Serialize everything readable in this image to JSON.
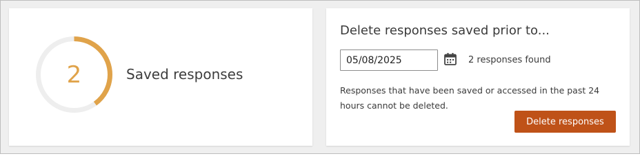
{
  "saved_summary": {
    "count": "2",
    "label": "Saved responses",
    "ring_progress": 0.4,
    "accent_color": "#e0a34a",
    "track_color": "#eeeeee"
  },
  "delete_panel": {
    "title": "Delete responses saved prior to...",
    "date_value": "05/08/2025",
    "calendar_icon": "calendar-icon",
    "found_text": "2 responses found",
    "note": "Responses that have been saved or accessed in the past 24 hours cannot be deleted.",
    "button_label": "Delete responses",
    "button_color": "#bf5218"
  }
}
